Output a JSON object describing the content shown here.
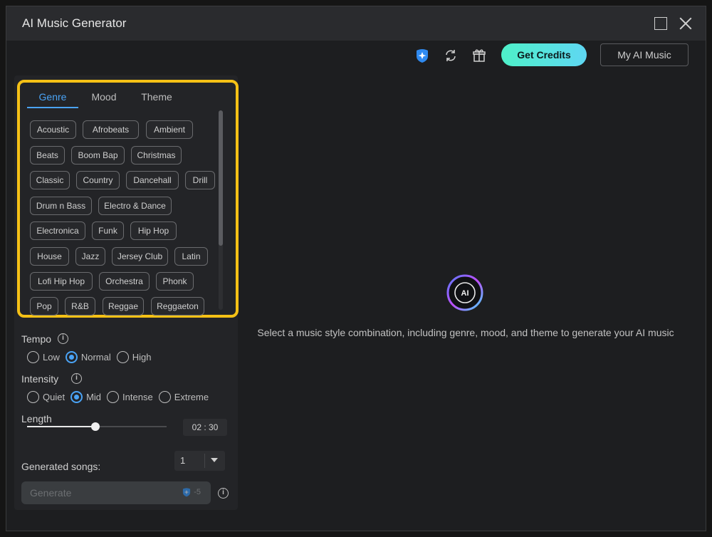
{
  "window": {
    "title": "AI Music Generator"
  },
  "toolbar": {
    "get_credits": "Get Credits",
    "my_music": "My AI Music"
  },
  "tabs": [
    {
      "label": "Genre",
      "active": true
    },
    {
      "label": "Mood",
      "active": false
    },
    {
      "label": "Theme",
      "active": false
    }
  ],
  "genres": [
    "Acoustic",
    "Afrobeats",
    "Ambient",
    "Beats",
    "Boom Bap",
    "Christmas",
    "Classic",
    "Country",
    "Dancehall",
    "Drill",
    "Drum n Bass",
    "Electro & Dance",
    "Electronica",
    "Funk",
    "Hip Hop",
    "House",
    "Jazz",
    "Jersey Club",
    "Latin",
    "Lofi Hip Hop",
    "Orchestra",
    "Phonk",
    "Pop",
    "R&B",
    "Reggae",
    "Reggaeton"
  ],
  "tempo": {
    "label": "Tempo",
    "options": [
      "Low",
      "Normal",
      "High"
    ],
    "selected": "Normal"
  },
  "intensity": {
    "label": "Intensity",
    "options": [
      "Quiet",
      "Mid",
      "Intense",
      "Extreme"
    ],
    "selected": "Mid"
  },
  "length": {
    "label": "Length",
    "value": "02 : 30",
    "fraction": 0.49
  },
  "generated": {
    "label": "Generated songs:",
    "value": "1"
  },
  "generate": {
    "label": "Generate",
    "cost": "-5"
  },
  "hint": "Select a music style combination, including genre, mood, and theme to generate your AI music",
  "logo_text": "AI",
  "colors": {
    "accent": "#4aa3f5",
    "highlight": "#f5c116",
    "credits_gradient_start": "#4ef0c8",
    "credits_gradient_end": "#5fd7f3"
  }
}
